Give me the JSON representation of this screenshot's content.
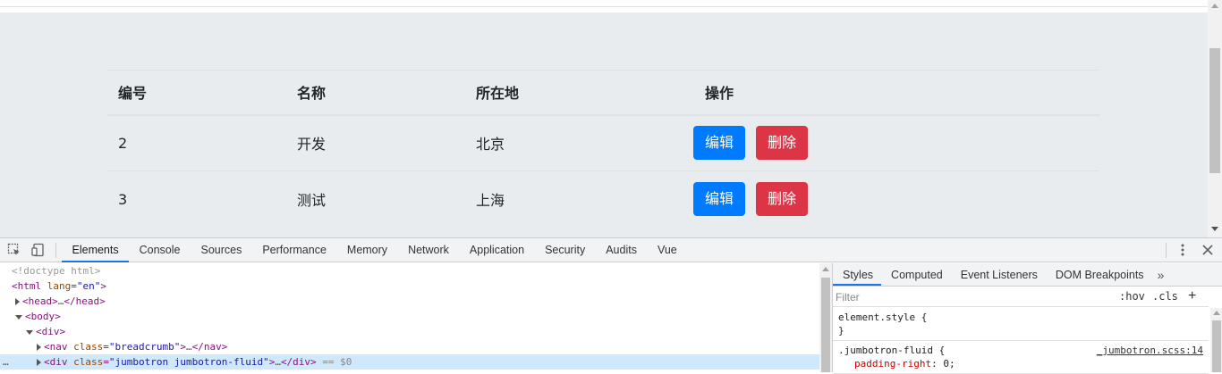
{
  "table": {
    "headers": [
      "编号",
      "名称",
      "所在地",
      "操作"
    ],
    "rows": [
      {
        "id": "2",
        "name": "开发",
        "location": "北京"
      },
      {
        "id": "3",
        "name": "测试",
        "location": "上海"
      }
    ],
    "edit_label": "编辑",
    "delete_label": "删除",
    "colors": {
      "edit": "#007bff",
      "delete": "#dc3545",
      "background": "#e9ecef"
    }
  },
  "devtools": {
    "toolbar_icons": [
      "inspect-element-icon",
      "device-toggle-icon"
    ],
    "tabs": [
      "Elements",
      "Console",
      "Sources",
      "Performance",
      "Memory",
      "Network",
      "Application",
      "Security",
      "Audits",
      "Vue"
    ],
    "active_tab": "Elements",
    "dom": {
      "doctype": "<!doctype html>",
      "html_tag": "html",
      "html_attr_name": "lang",
      "html_attr_value": "\"en\"",
      "head_open": "head",
      "head_ellipsis": "…",
      "head_close": "</head>",
      "body_tag": "body",
      "div_tag": "div",
      "nav_tag": "nav",
      "nav_attr_name": "class",
      "nav_attr_value": "\"breadcrumb\"",
      "nav_ellipsis": "…",
      "nav_close": "</nav>",
      "jumbo_tag": "div",
      "jumbo_attr_name": "class",
      "jumbo_attr_value": "\"jumbotron jumbotron-fluid\"",
      "jumbo_ellipsis": "…",
      "jumbo_close": "</div>",
      "selected_marker": "== $0",
      "gutter_dots": "…"
    },
    "styles_tabs": [
      "Styles",
      "Computed",
      "Event Listeners",
      "DOM Breakpoints"
    ],
    "styles_more": "»",
    "filter_placeholder": "Filter",
    "hov": ":hov",
    "cls": ".cls",
    "plus": "+",
    "rules": {
      "element_style_open": "element.style {",
      "element_style_close": "}",
      "jumbo_selector": ".jumbotron-fluid {",
      "jumbo_source": "_jumbotron.scss:14",
      "jumbo_prop_name": "padding-right",
      "jumbo_prop_value": ": 0;"
    }
  }
}
